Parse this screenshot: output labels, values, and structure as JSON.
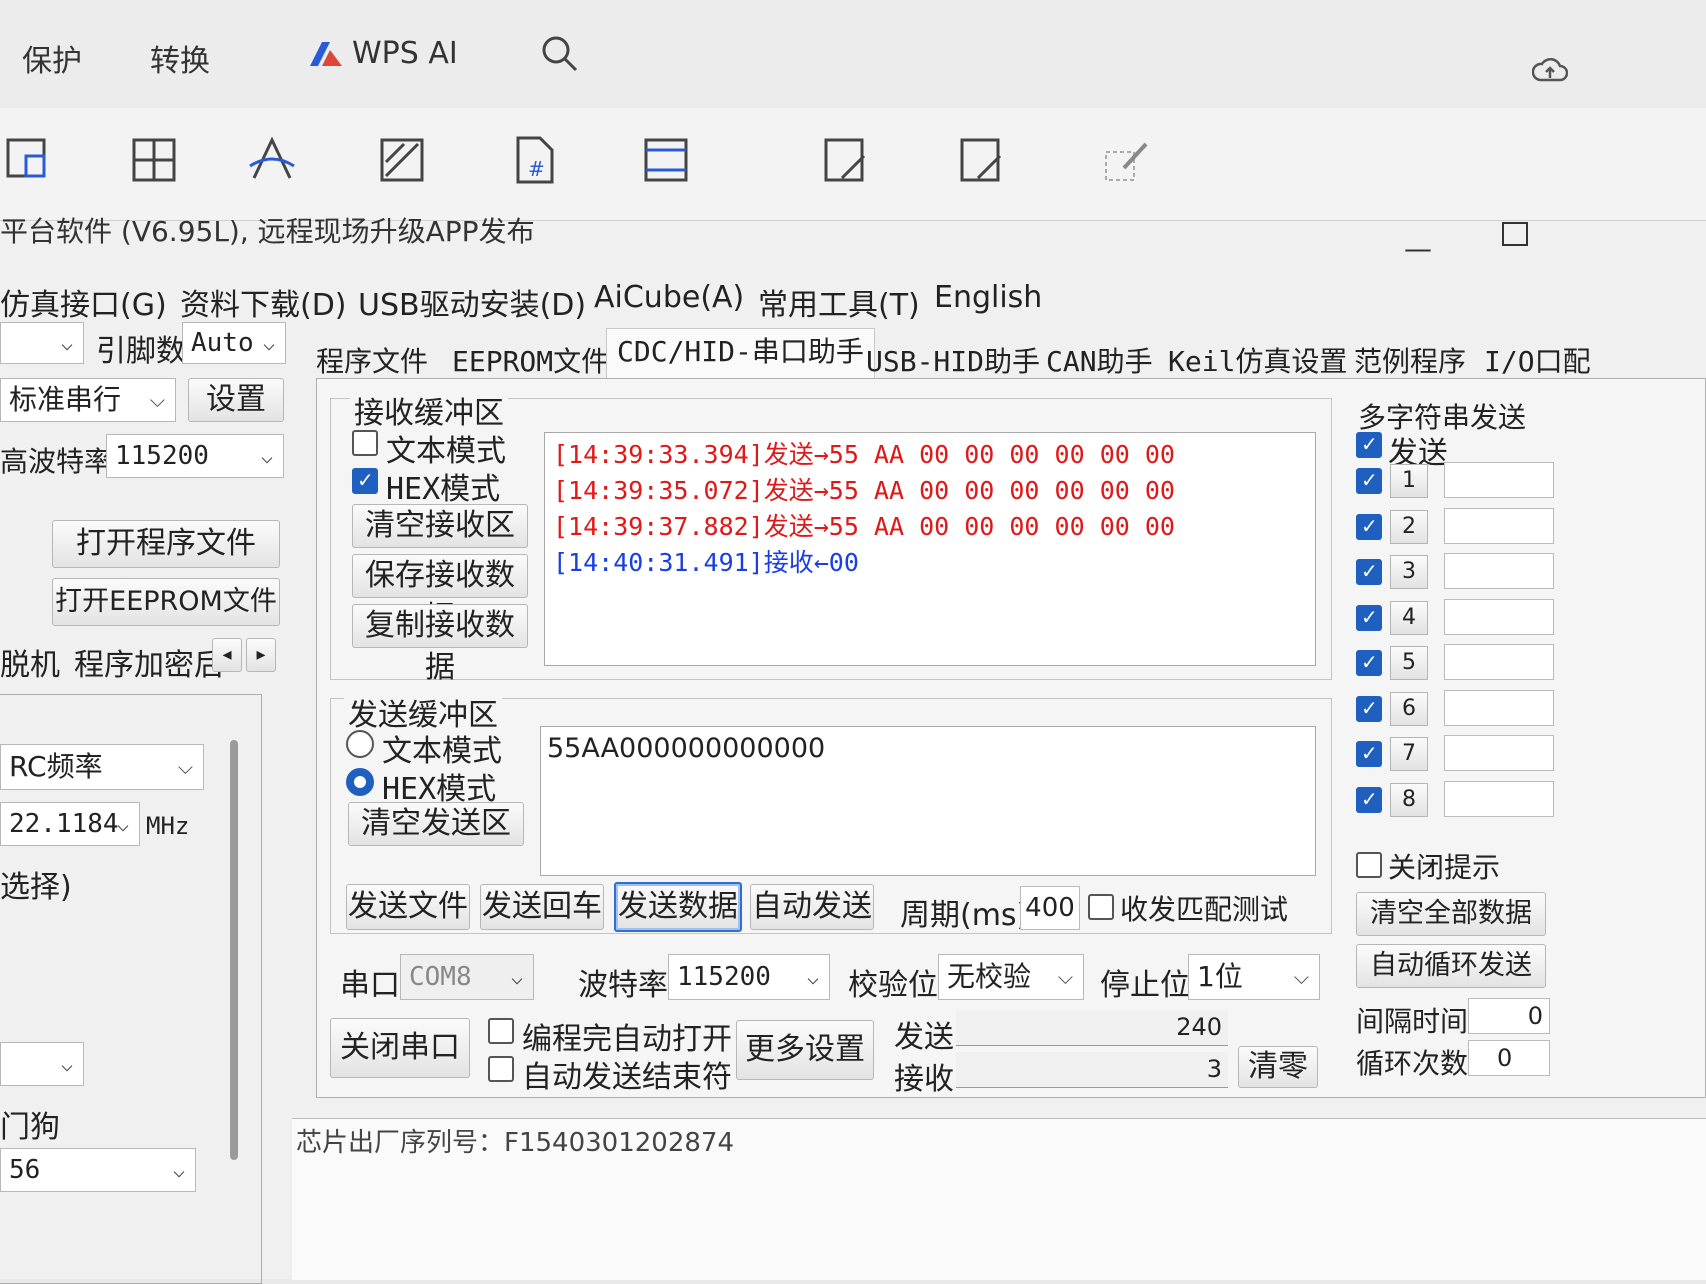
{
  "wps": {
    "menu": [
      "保护",
      "转换",
      "WPS AI"
    ],
    "tool_icons": [
      "crop-icon",
      "table-grid-icon",
      "text-style-icon",
      "fill-icon",
      "page-number-icon",
      "frame-icon",
      "edit-sign-icon",
      "signature-icon",
      "pen-icon"
    ]
  },
  "window": {
    "title": "平台软件 (V6.95L), 远程现场升级APP发布",
    "menus": [
      "仿真接口(G)",
      "资料下载(D)",
      "USB驱动安装(D)",
      "AiCube(A)",
      "常用工具(T)",
      "English"
    ],
    "minimize": "—"
  },
  "left": {
    "pin_label": "引脚数",
    "pin_value": "Auto",
    "serial_type": "标准串行",
    "settings_btn": "设置",
    "baud_label": "高波特率",
    "baud_value": "115200",
    "open_program": "打开程序文件",
    "open_eeprom": "打开EEPROM文件",
    "offline": "脱机",
    "encrypt": "程序加密后",
    "rc_label": "RC频率",
    "freq_value": "22.1184",
    "freq_unit": "MHz",
    "select_hint": "选择)",
    "watchdog": "门狗",
    "bottom_value": "56"
  },
  "tabs": [
    "程序文件",
    "EEPROM文件",
    "CDC/HID-串口助手",
    "USB-HID助手",
    "CAN助手",
    "Keil仿真设置",
    "范例程序",
    "I/O口配"
  ],
  "receive": {
    "title": "接收缓冲区",
    "text_mode": "文本模式",
    "hex_mode": "HEX模式",
    "clear_btn": "清空接收区",
    "save_btn": "保存接收数据",
    "copy_btn": "复制接收数据",
    "log": [
      {
        "text": "[14:39:33.394]发送→55 AA 00 00 00 00 00 00",
        "color": "#e01818"
      },
      {
        "text": "[14:39:35.072]发送→55 AA 00 00 00 00 00 00",
        "color": "#e01818"
      },
      {
        "text": "[14:39:37.882]发送→55 AA 00 00 00 00 00 00",
        "color": "#e01818"
      },
      {
        "text": "[14:40:31.491]接收←00",
        "color": "#1a3fe0"
      }
    ]
  },
  "send": {
    "title": "发送缓冲区",
    "text_mode": "文本模式",
    "hex_mode": "HEX模式",
    "clear_btn": "清空发送区",
    "content": "55AA000000000000",
    "send_file": "发送文件",
    "send_enter": "发送回车",
    "send_data": "发送数据",
    "auto_send": "自动发送",
    "period_label": "周期(ms)",
    "period_value": "400",
    "match_test": "收发匹配测试"
  },
  "port": {
    "port_label": "串口",
    "port_value": "COM8",
    "baud_label": "波特率",
    "baud_value": "115200",
    "parity_label": "校验位",
    "parity_value": "无校验",
    "stop_label": "停止位",
    "stop_value": "1位",
    "close_btn": "关闭串口",
    "auto_open": "编程完自动打开",
    "auto_end": "自动发送结束符",
    "more_btn": "更多设置",
    "send_label": "发送",
    "send_count": "240",
    "recv_label": "接收",
    "recv_count": "3",
    "clear_btn": "清零"
  },
  "multi": {
    "title": "多字符串发送",
    "send_header": "发送",
    "items": [
      "1",
      "2",
      "3",
      "4",
      "5",
      "6",
      "7",
      "8"
    ],
    "close_tip": "关闭提示",
    "clear_all": "清空全部数据",
    "auto_loop": "自动循环发送",
    "interval_label": "间隔时间",
    "interval_value": "0",
    "loop_label": "循环次数",
    "loop_value": "0"
  },
  "footer_text": "芯片出厂序列号：F1540301202874"
}
